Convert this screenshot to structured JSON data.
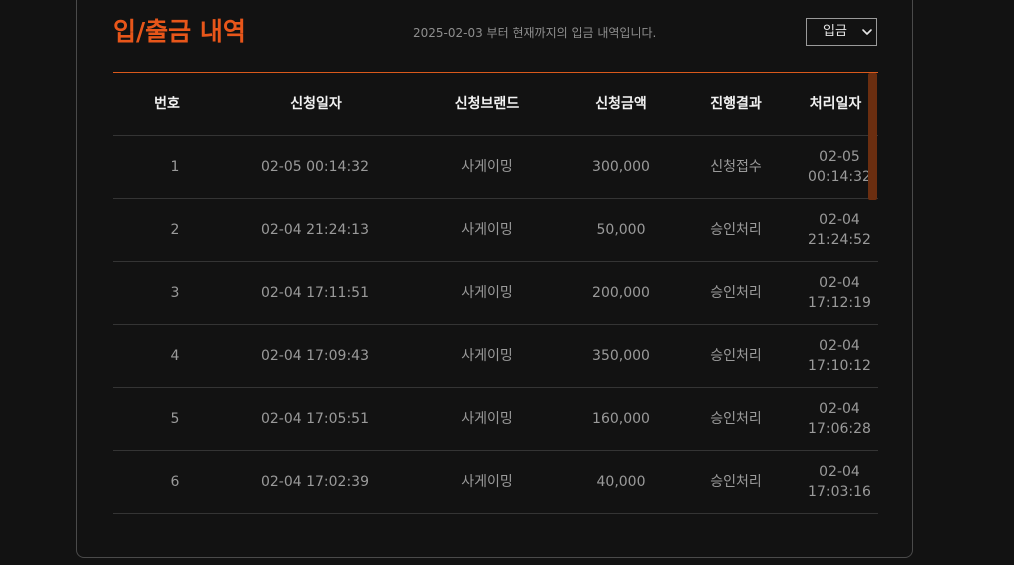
{
  "page": {
    "title": "입/출금 내역",
    "description": "2025-02-03 부터 현재까지의 입금 내역입니다."
  },
  "filter": {
    "selected": "입금"
  },
  "table": {
    "headers": [
      "번호",
      "신청일자",
      "신청브랜드",
      "신청금액",
      "진행결과",
      "처리일자"
    ],
    "rows": [
      [
        "1",
        "02-05 00:14:32",
        "사게이밍",
        "300,000",
        "신청접수",
        "02-05\n00:14:32"
      ],
      [
        "2",
        "02-04 21:24:13",
        "사게이밍",
        "50,000",
        "승인처리",
        "02-04\n21:24:52"
      ],
      [
        "3",
        "02-04 17:11:51",
        "사게이밍",
        "200,000",
        "승인처리",
        "02-04\n17:12:19"
      ],
      [
        "4",
        "02-04 17:09:43",
        "사게이밍",
        "350,000",
        "승인처리",
        "02-04\n17:10:12"
      ],
      [
        "5",
        "02-04 17:05:51",
        "사게이밍",
        "160,000",
        "승인처리",
        "02-04\n17:06:28"
      ],
      [
        "6",
        "02-04 17:02:39",
        "사게이밍",
        "40,000",
        "승인처리",
        "02-04\n17:03:16"
      ]
    ]
  },
  "colors": {
    "accent": "#e8561a",
    "background": "#121212",
    "scrollbar": "#6b2e10"
  },
  "icons": {
    "select": "chevron-down-icon"
  }
}
